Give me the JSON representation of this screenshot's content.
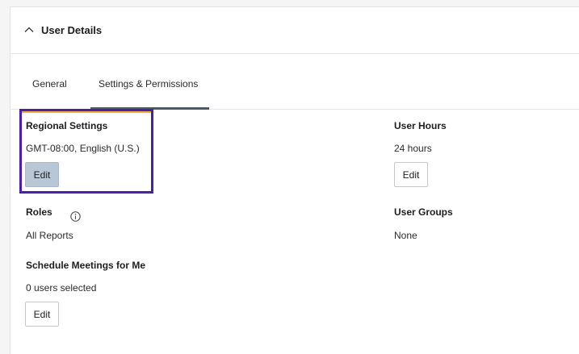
{
  "header": {
    "title": "User Details",
    "toggle_icon": "chevron-up-icon"
  },
  "tabs": [
    {
      "label": "General",
      "selected": false
    },
    {
      "label": "Settings & Permissions",
      "selected": true
    }
  ],
  "regional_settings": {
    "title": "Regional Settings",
    "value": "GMT-08:00, English (U.S.)",
    "edit_label": "Edit"
  },
  "user_hours": {
    "title": "User Hours",
    "value": "24 hours",
    "edit_label": "Edit"
  },
  "roles": {
    "title": "Roles",
    "info_icon": "info-icon",
    "value": "All Reports"
  },
  "user_groups": {
    "title": "User Groups",
    "value": "None"
  },
  "schedule_meetings": {
    "title": "Schedule Meetings for Me",
    "value": "0 users selected",
    "edit_label": "Edit"
  },
  "colors": {
    "highlight_border": "#4b1fa8",
    "highlight_accent": "#f0b23a",
    "tab_underline": "#4a5a6a",
    "active_button": "#b7c7d6"
  }
}
